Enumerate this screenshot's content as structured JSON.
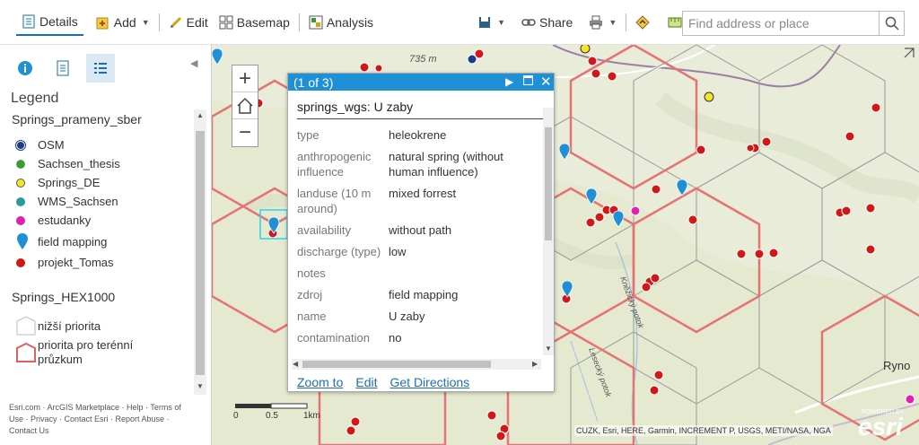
{
  "toolbar": {
    "details": "Details",
    "add": "Add",
    "edit": "Edit",
    "basemap": "Basemap",
    "analysis": "Analysis",
    "share": "Share",
    "search_placeholder": "Find address or place"
  },
  "sidebar": {
    "legend_title": "Legend",
    "layer1": "Springs_prameny_sber",
    "layer1_items": [
      {
        "label": "OSM",
        "color": "#1d3a8f"
      },
      {
        "label": "Sachsen_thesis",
        "color": "#3a9b3a"
      },
      {
        "label": "Springs_DE",
        "color": "#f5e52a"
      },
      {
        "label": "WMS_Sachsen",
        "color": "#2a9b9b"
      },
      {
        "label": "estudanky",
        "color": "#e020b0"
      },
      {
        "label": "field mapping",
        "color": "#1f8fd6"
      },
      {
        "label": "projekt_Tomas",
        "color": "#d01818"
      }
    ],
    "layer2": "Springs_HEX1000",
    "layer2_items": [
      {
        "label": "nižší priorita"
      },
      {
        "label": "priorita pro terénní průzkum"
      }
    ],
    "footer": "Esri.com · ArcGIS Marketplace · Help · Terms of Use · Privacy · Contact Esri · Report Abuse · Contact Us"
  },
  "popup": {
    "counter": "(1 of 3)",
    "title": "springs_wgs: U zaby",
    "rows": [
      {
        "k": "type",
        "v": "heleokrene"
      },
      {
        "k": "anthropogenic influence",
        "v": "natural spring (without human influence)"
      },
      {
        "k": "landuse (10 m around)",
        "v": "mixed forrest"
      },
      {
        "k": "availability",
        "v": "without path"
      },
      {
        "k": "discharge (type)",
        "v": "low"
      },
      {
        "k": "notes",
        "v": ""
      },
      {
        "k": "zdroj",
        "v": "field mapping"
      },
      {
        "k": "name",
        "v": "U zaby"
      },
      {
        "k": "contamination",
        "v": "no"
      }
    ],
    "zoom_to": "Zoom to",
    "edit": "Edit",
    "directions": "Get Directions"
  },
  "map": {
    "elev_label": "735 m",
    "place_label": "Ryno",
    "stream_label1": "Kněžický potok",
    "stream_label2": "Lesecký potok",
    "scale_0": "0",
    "scale_1": "0.5",
    "scale_2": "1km",
    "attribution": "CUZK, Esri, HERE, Garmin, INCREMENT P, USGS, METI/NASA, NGA",
    "powered": "POWERED BY",
    "esri": "esri"
  }
}
